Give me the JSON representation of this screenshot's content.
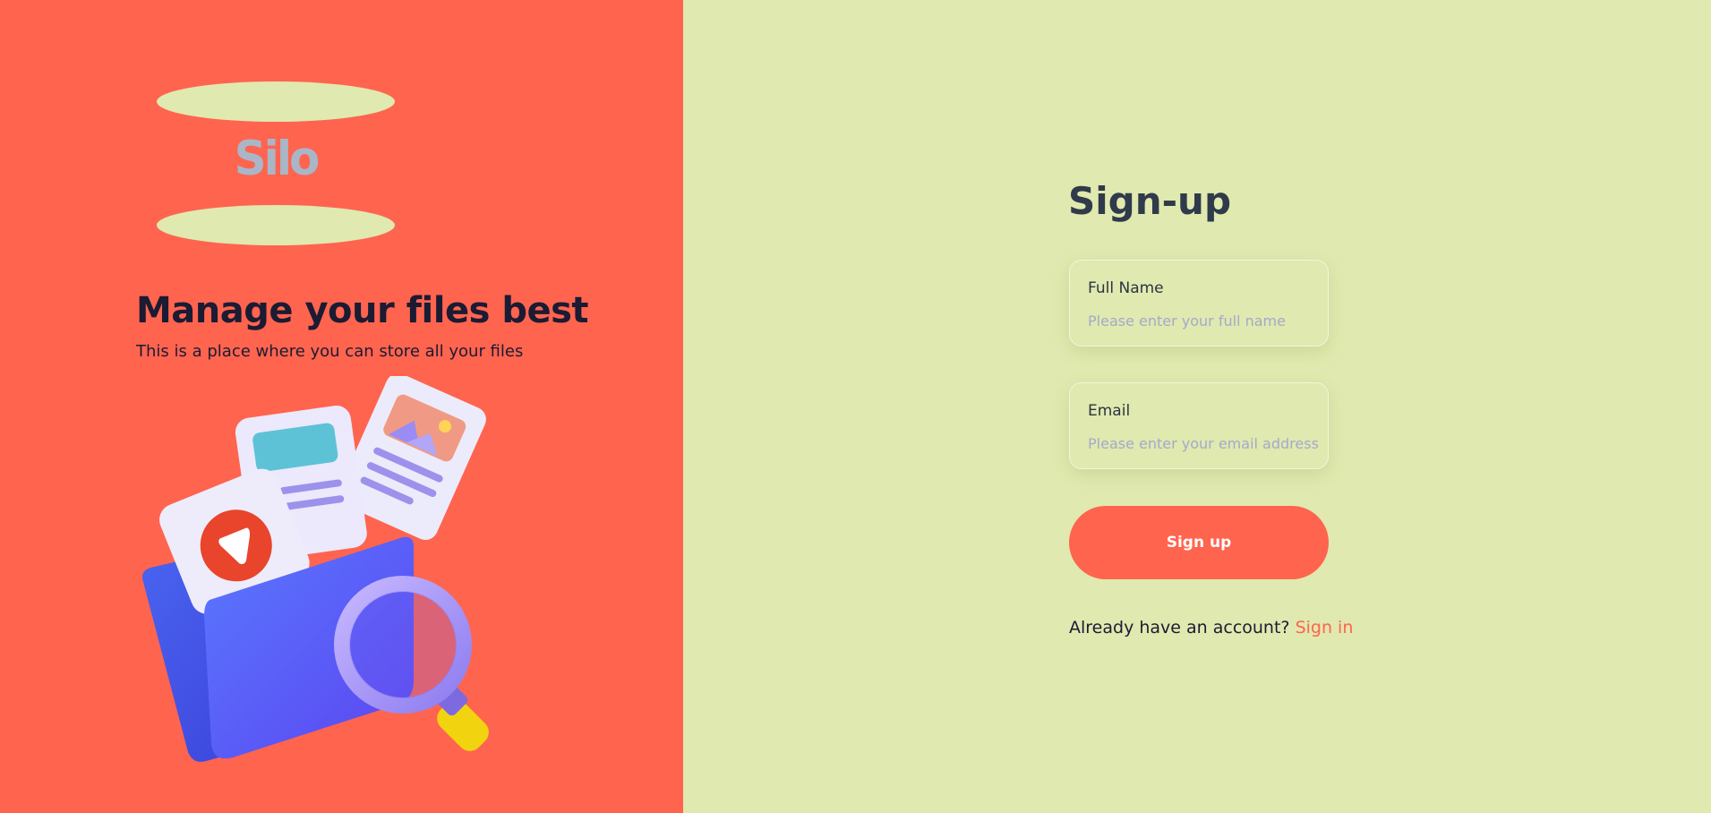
{
  "brand": {
    "logo_text": "Silo",
    "headline": "Manage your files best",
    "tagline": "This is a place where you can store all your files"
  },
  "illustration": {
    "icon": "folder-files-magnifier-icon"
  },
  "form": {
    "title": "Sign-up",
    "full_name": {
      "label": "Full Name",
      "placeholder": "Please enter your full name",
      "value": ""
    },
    "email": {
      "label": "Email",
      "placeholder": "Please enter your email address",
      "value": ""
    },
    "submit_label": "Sign up",
    "account_prompt": "Already have an account?",
    "signin_link": "Sign in"
  },
  "colors": {
    "accent": "#ff644f",
    "background": "#e0e9af",
    "text_dark": "#1b1b33"
  }
}
